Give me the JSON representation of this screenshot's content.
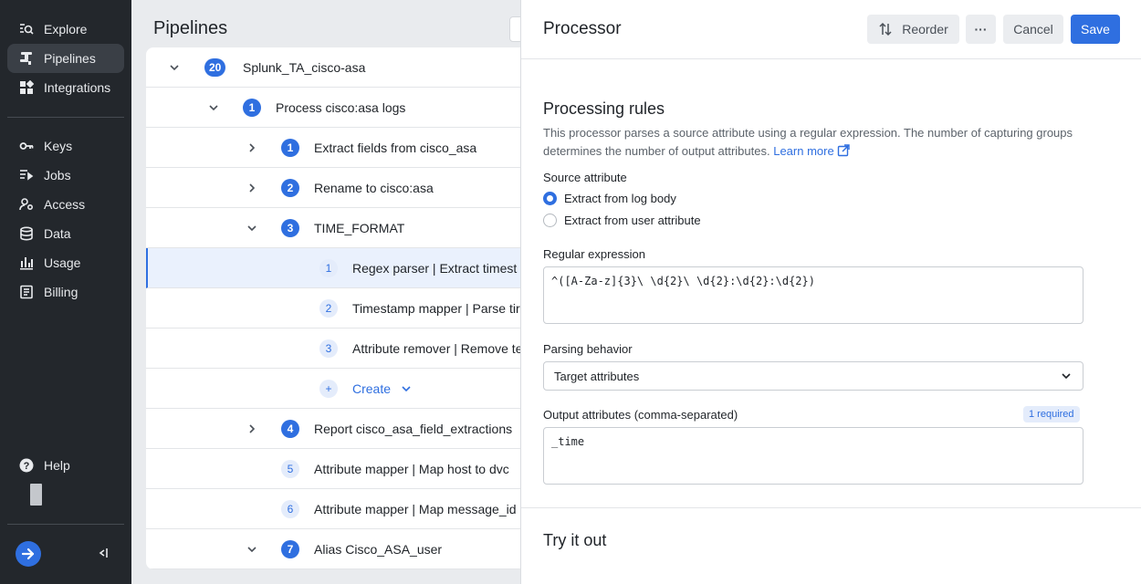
{
  "sidebar": {
    "nav": [
      {
        "label": "Explore",
        "icon": "explore-icon"
      },
      {
        "label": "Pipelines",
        "icon": "pipelines-icon",
        "active": true
      },
      {
        "label": "Integrations",
        "icon": "integrations-icon"
      },
      {
        "label": "Keys",
        "icon": "key-icon"
      },
      {
        "label": "Jobs",
        "icon": "jobs-icon"
      },
      {
        "label": "Access",
        "icon": "access-icon"
      },
      {
        "label": "Data",
        "icon": "database-icon"
      },
      {
        "label": "Usage",
        "icon": "bar-chart-icon"
      },
      {
        "label": "Billing",
        "icon": "billing-icon"
      }
    ],
    "help_label": "Help"
  },
  "main": {
    "title": "Pipelines",
    "rows": [
      {
        "badge": "20",
        "text": "Splunk_TA_cisco-asa",
        "expanded": true
      },
      {
        "badge": "1",
        "text": "Process cisco:asa logs",
        "expanded": true
      },
      {
        "badge": "1",
        "text": "Extract fields from cisco_asa",
        "expanded": false
      },
      {
        "badge": "2",
        "text": "Rename to cisco:asa",
        "expanded": false
      },
      {
        "badge": "3",
        "text": "TIME_FORMAT",
        "expanded": true
      },
      {
        "badge": "1",
        "text": "Regex parser  |  Extract timest",
        "selected": true
      },
      {
        "badge": "2",
        "text": "Timestamp mapper  |  Parse tir"
      },
      {
        "badge": "3",
        "text": "Attribute remover  |  Remove te"
      },
      {
        "text": "Create"
      },
      {
        "badge": "4",
        "text": "Report cisco_asa_field_extractions",
        "expanded": false
      },
      {
        "badge": "5",
        "text": "Attribute mapper  |  Map host to dvc"
      },
      {
        "badge": "6",
        "text": "Attribute mapper  |  Map message_id"
      },
      {
        "badge": "7",
        "text": "Alias Cisco_ASA_user",
        "expanded": true
      }
    ]
  },
  "panel": {
    "title": "Processor",
    "reorder_label": "Reorder",
    "more_label": "···",
    "cancel_label": "Cancel",
    "save_label": "Save",
    "section_title": "Processing rules",
    "description": "This processor parses a source attribute using a regular expression. The number of capturing groups determines the number of output attributes.",
    "learn_more": "Learn more",
    "source_label": "Source attribute",
    "source_options": [
      "Extract from log body",
      "Extract from user attribute"
    ],
    "regex_label": "Regular expression",
    "regex_value": "^([A-Za-z]{3}\\ \\d{2}\\ \\d{2}:\\d{2}:\\d{2})",
    "parsing_label": "Parsing behavior",
    "parsing_value": "Target attributes",
    "output_label": "Output attributes (comma-separated)",
    "required_badge": "1 required",
    "output_value": "_time",
    "try_title": "Try it out"
  },
  "colors": {
    "accent": "#2f6fe0",
    "sidebar": "#23272c"
  }
}
